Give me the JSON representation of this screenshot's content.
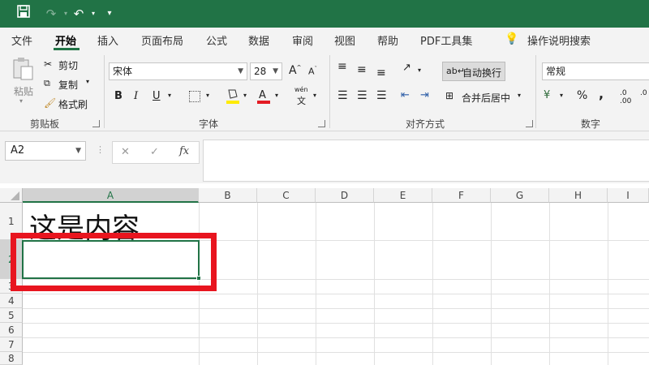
{
  "quick_access": {
    "save_icon": "save-icon",
    "redo_icon": "redo-icon",
    "undo_icon": "undo-icon",
    "customize": "▾"
  },
  "menu": [
    "文件",
    "开始",
    "插入",
    "页面布局",
    "公式",
    "数据",
    "审阅",
    "视图",
    "帮助",
    "PDF工具集"
  ],
  "tell_me": "操作说明搜索",
  "clipboard": {
    "paste": "粘贴",
    "cut": "剪切",
    "copy": "复制",
    "format_painter": "格式刷",
    "label": "剪贴板"
  },
  "font": {
    "name": "宋体",
    "size": "28",
    "label": "字体",
    "bold": "B",
    "italic": "I",
    "underline": "U",
    "phonetic": "wén"
  },
  "alignment": {
    "wrap": "自动换行",
    "merge": "合并后居中",
    "label": "对齐方式"
  },
  "number": {
    "format": "常规",
    "percent": "%",
    "comma": ",",
    "label": "数字"
  },
  "formula_bar": {
    "name_box": "A2",
    "cancel": "✕",
    "enter": "✓",
    "fx": "fx",
    "value": ""
  },
  "grid": {
    "columns": [
      "A",
      "B",
      "C",
      "D",
      "E",
      "F",
      "G",
      "H",
      "I"
    ],
    "rows": [
      "1",
      "2",
      "3",
      "4",
      "5",
      "6",
      "7",
      "8"
    ],
    "a1_content": "这是内容",
    "active_cell": "A2"
  },
  "colors": {
    "accent": "#217346",
    "highlight": "#e8151f"
  }
}
